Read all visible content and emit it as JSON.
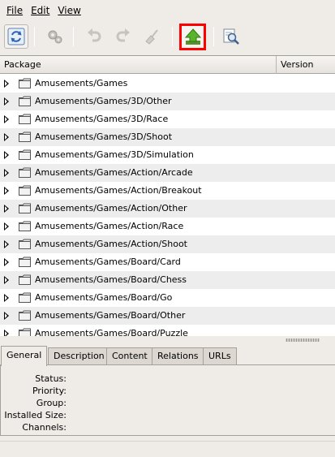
{
  "menubar": {
    "file": "File",
    "edit": "Edit",
    "view": "View"
  },
  "toolbar": {
    "buttons": [
      {
        "name": "refresh-icon",
        "enabled": true
      },
      {
        "name": "preferences-icon",
        "enabled": false
      },
      {
        "name": "undo-icon",
        "enabled": false
      },
      {
        "name": "redo-icon",
        "enabled": false
      },
      {
        "name": "clear-icon",
        "enabled": false
      },
      {
        "name": "update-icon",
        "enabled": true,
        "highlighted": true
      },
      {
        "name": "search-icon",
        "enabled": true
      }
    ],
    "highlight_color": "#ff0000"
  },
  "package_list": {
    "columns": [
      "Package",
      "Version"
    ],
    "rows": [
      "Amusements/Games",
      "Amusements/Games/3D/Other",
      "Amusements/Games/3D/Race",
      "Amusements/Games/3D/Shoot",
      "Amusements/Games/3D/Simulation",
      "Amusements/Games/Action/Arcade",
      "Amusements/Games/Action/Breakout",
      "Amusements/Games/Action/Other",
      "Amusements/Games/Action/Race",
      "Amusements/Games/Action/Shoot",
      "Amusements/Games/Board/Card",
      "Amusements/Games/Board/Chess",
      "Amusements/Games/Board/Go",
      "Amusements/Games/Board/Other",
      "Amusements/Games/Board/Puzzle"
    ]
  },
  "details": {
    "tabs": [
      "General",
      "Description",
      "Content",
      "Relations",
      "URLs"
    ],
    "active_tab": "General",
    "fields": [
      {
        "label": "Status:",
        "value": ""
      },
      {
        "label": "Priority:",
        "value": ""
      },
      {
        "label": "Group:",
        "value": ""
      },
      {
        "label": "Installed Size:",
        "value": ""
      },
      {
        "label": "Channels:",
        "value": ""
      }
    ]
  }
}
